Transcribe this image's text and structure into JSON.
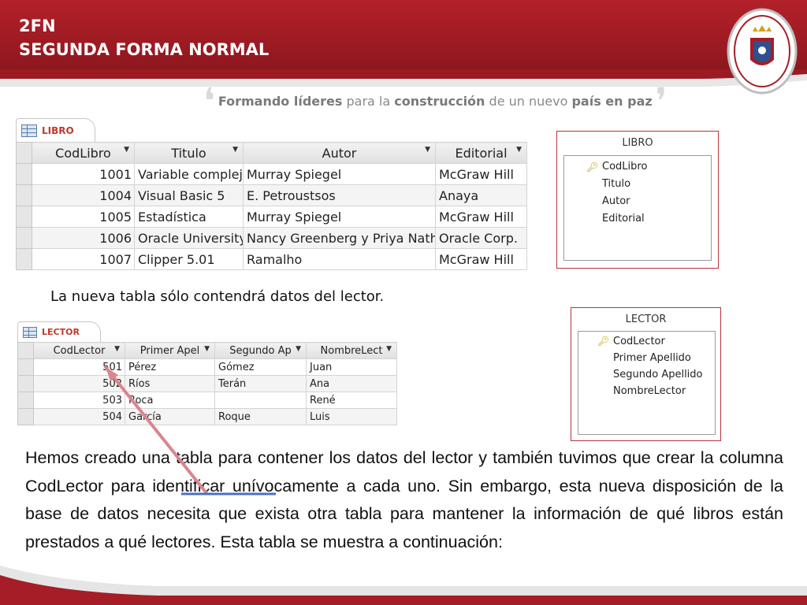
{
  "header": {
    "title_line1": "2FN",
    "title_line2": "SEGUNDA FORMA NORMAL"
  },
  "motto": {
    "part1": "Formando líderes",
    "part2": "para la",
    "part3": "construcción",
    "part4": "de un nuevo",
    "part5": "país en paz"
  },
  "colors": {
    "header_red": "#a51d26",
    "frame_red": "#b8333c",
    "tab_text": "#c0392b"
  },
  "libro_sheet": {
    "tab_label": "LIBRO",
    "columns": [
      "CodLibro",
      "Titulo",
      "Autor",
      "Editorial"
    ],
    "rows": [
      [
        "1001",
        "Variable compleja",
        "Murray Spiegel",
        "McGraw Hill"
      ],
      [
        "1004",
        "Visual Basic 5",
        "E. Petroustsos",
        "Anaya"
      ],
      [
        "1005",
        "Estadística",
        "Murray Spiegel",
        "McGraw Hill"
      ],
      [
        "1006",
        "Oracle University",
        "Nancy Greenberg y Priya Nathan",
        "Oracle Corp."
      ],
      [
        "1007",
        "Clipper 5.01",
        "Ramalho",
        "McGraw Hill"
      ]
    ]
  },
  "libro_schema": {
    "title": "LIBRO",
    "fields": [
      "CodLibro",
      "Titulo",
      "Autor",
      "Editorial"
    ]
  },
  "caption": "La nueva tabla sólo contendrá datos del lector.",
  "lector_sheet": {
    "tab_label": "LECTOR",
    "columns": [
      "CodLector",
      "Primer Apel",
      "Segundo Ap",
      "NombreLect"
    ],
    "rows": [
      [
        "501",
        "Pérez",
        "Gómez",
        "Juan"
      ],
      [
        "502",
        "Ríos",
        "Terán",
        "Ana"
      ],
      [
        "503",
        "Roca",
        "",
        "René"
      ],
      [
        "504",
        "García",
        "Roque",
        "Luis"
      ]
    ]
  },
  "lector_schema": {
    "title": "LECTOR",
    "fields": [
      "CodLector",
      "Primer Apellido",
      "Segundo Apellido",
      "NombreLector"
    ]
  },
  "body": {
    "paragraph": "Hemos creado una tabla para contener los datos del lector y también tuvimos que crear la columna CodLector para identificar unívocamente a cada uno. Sin embargo, esta nueva disposición de la base de datos necesita que exista otra tabla para mantener la información de qué libros están prestados a qué lectores. Esta tabla se muestra a continuación:"
  }
}
